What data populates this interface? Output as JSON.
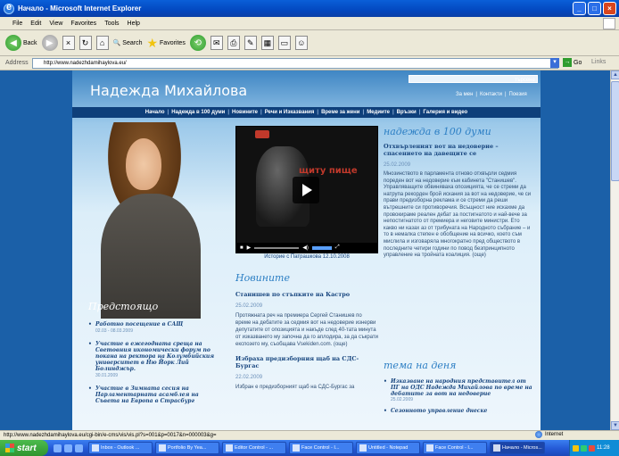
{
  "window": {
    "title": "Начало - Microsoft Internet Explorer",
    "controls": {
      "minimize": "_",
      "maximize": "□",
      "close": "×"
    }
  },
  "menu": [
    "File",
    "Edit",
    "View",
    "Favorites",
    "Tools",
    "Help"
  ],
  "toolbar": {
    "back": "Back",
    "forward": "",
    "stop": "×",
    "refresh": "↻",
    "home": "⌂",
    "search": "Search",
    "favorites": "Favorites"
  },
  "address": {
    "label": "Address",
    "url": "http://www.nadezhdamihaylova.eu/",
    "go": "Go",
    "links": "Links"
  },
  "site": {
    "name": "Надежда Михайлова",
    "search_label": "търсене",
    "top_links": [
      "За мен",
      "Контакти",
      "Поезия"
    ],
    "nav": [
      "Начало",
      "Надежда в 100 думи",
      "Новините",
      "Речи и Изказвания",
      "Време за жени",
      "Медиите",
      "Връзки",
      "Галерия и видео"
    ]
  },
  "left": {
    "section_title": "Предстоящо",
    "items": [
      {
        "title": "Работно посещение в САЩ",
        "date": "02.03 - 08.03.2009"
      },
      {
        "title": "Участие в ежегодната среща на Световния икономически форум по покана на ректора на Колумбийския университет в Ню Йорк Лий Болинджър.",
        "date": "30.01.2009"
      },
      {
        "title": "Участие в Зимната сесия на Парламентарната асамблея на Съвета на Европа в Страсбург",
        "date": ""
      }
    ]
  },
  "video": {
    "overlay_text": "щиту пище",
    "caption": "Историе с Патрашкова 12.10.2008"
  },
  "center": {
    "section_title": "Новините",
    "articles": [
      {
        "title": "Станишев по стъпките на Кастро",
        "date": "25.02.2009",
        "body": "Протяжната реч на премиера Сергей Станишев по време на дебатите за седмия вот на недоверие изнерви депутатите от опозицията и накъде след 40-тата минута от изказването му започна да го аплодира, за да съкрати експозето му, съобщава Vsekiden.com. (още)"
      },
      {
        "title": "Избрахa предизборния щаб на СДС-Бургас",
        "date": "22.02.2009",
        "body": "Избран е предизборният щаб на СДС-Бургас за"
      }
    ]
  },
  "right": {
    "section_title": "надежда в 100 думи",
    "article": {
      "title": "Отхвърленият вот на недоверие – спасението на давещите се",
      "date": "25.02.2009",
      "body": "Мнозинството в парламента отново отхвърли седмия пореден вот на недоверие към кабинета \"Станишев\". Управляващите обвиняваха опозицията, че се стреми да натрупа рекорден брой искания за вот на недоверие, че си прави предизборна реклама и се стреми да реши вътрешните си противоречия. Всъщност ние искахме да провокираме реален дебат за постигнатото и най-вече за непостигнатото от премиера и неговите министри. Ето какво ни казах аз от трибуната на Народното събрание – и то в немалка степен е обобщение на всичко, което съм мислила и изговаряла многократно пред обществото в последните четири години по повод безпринципното управление на тройната коалиция. (още)"
    },
    "theme_title": "тема на деня",
    "theme_items": [
      {
        "title": "Изказване на народния представител от ПГ на ОДС Надежда Михайлова по време на дебатите за вот на недоверие",
        "date": "25.02.2009"
      },
      {
        "title": "Сезонното управление днеске",
        "date": ""
      }
    ]
  },
  "statusbar": {
    "url": "http://www.nadezhdamihaylova.eu/cgi-bin/e-cms/vis/vis.pl?s=001&p=0017&n=000003&g=",
    "zone": "Internet"
  },
  "taskbar": {
    "start": "start",
    "tasks": [
      "Inbox - Outlook ...",
      "Portfolio By Yea...",
      "Editor Control - ...",
      "Face Control - I...",
      "Untitled - Notepad",
      "Face Control - I...",
      "Начало - Micros..."
    ],
    "clock": "11:28"
  }
}
